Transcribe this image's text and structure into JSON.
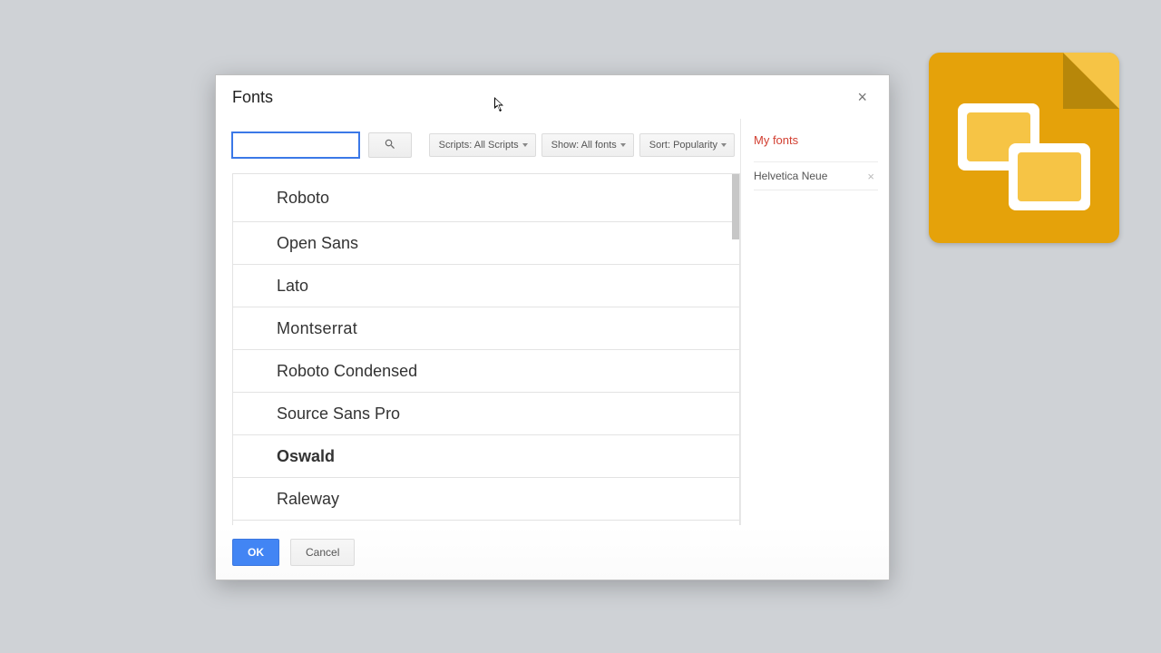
{
  "dialog": {
    "title": "Fonts",
    "close_label": "×"
  },
  "search": {
    "value": "",
    "placeholder": ""
  },
  "filters": {
    "scripts": "Scripts: All Scripts",
    "show": "Show: All fonts",
    "sort": "Sort: Popularity"
  },
  "fonts": [
    "Roboto",
    "Open Sans",
    "Lato",
    "Montserrat",
    "Roboto Condensed",
    "Source Sans Pro",
    "Oswald",
    "Raleway"
  ],
  "my_fonts": {
    "title": "My fonts",
    "items": [
      "Helvetica Neue"
    ]
  },
  "buttons": {
    "ok": "OK",
    "cancel": "Cancel"
  },
  "colors": {
    "primary": "#4285f4",
    "accent": "#d23f31",
    "logo_bg": "#e5a20a",
    "logo_fold": "#f6c445"
  }
}
